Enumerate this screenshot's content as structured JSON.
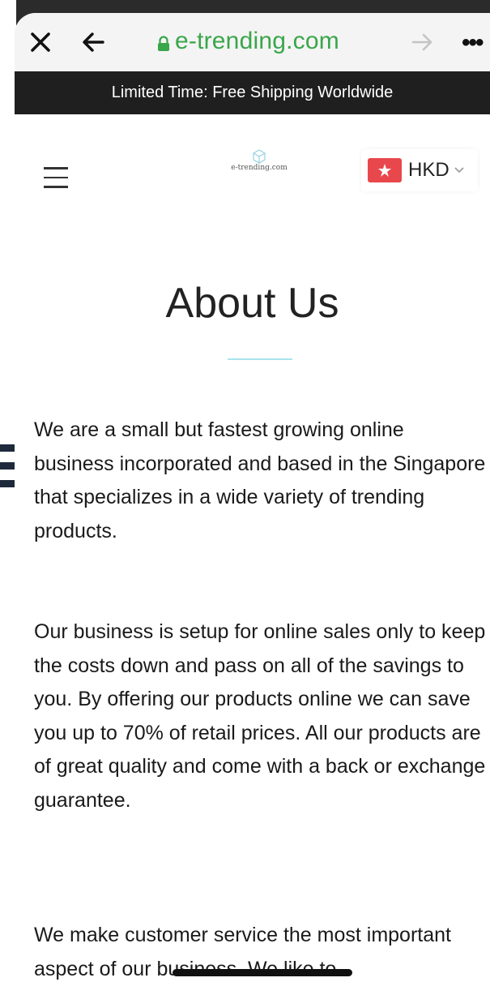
{
  "browser": {
    "url": "e-trending.com",
    "close_icon": "close-icon",
    "back_icon": "back-arrow-icon",
    "forward_icon": "forward-arrow-icon",
    "lock_icon": "lock-icon",
    "more_label": "•••",
    "url_color": "#3aa64a"
  },
  "announcement": {
    "text": "Limited Time: Free Shipping Worldwide",
    "background": "#1f1f1f"
  },
  "header": {
    "menu_icon": "hamburger-menu-icon",
    "logo_text": "e-trending.com",
    "currency": {
      "code": "HKD",
      "flag_icon": "hong-kong-flag-icon",
      "chevron_icon": "chevron-down-icon"
    }
  },
  "main": {
    "title": "About Us",
    "accent_color": "#a8e4ea",
    "paragraphs": [
      "We are a small but fastest growing online business incorporated and based in the Singapore that specializes in a wide variety of trending products.",
      "Our business is setup for online sales only to keep the costs down and pass on all of the savings to you. By offering our products online we can save you up to 70% of retail prices. All our products are of great quality and come with a back or exchange guarantee.",
      "We make customer service the most important aspect of our business. We like to"
    ]
  }
}
